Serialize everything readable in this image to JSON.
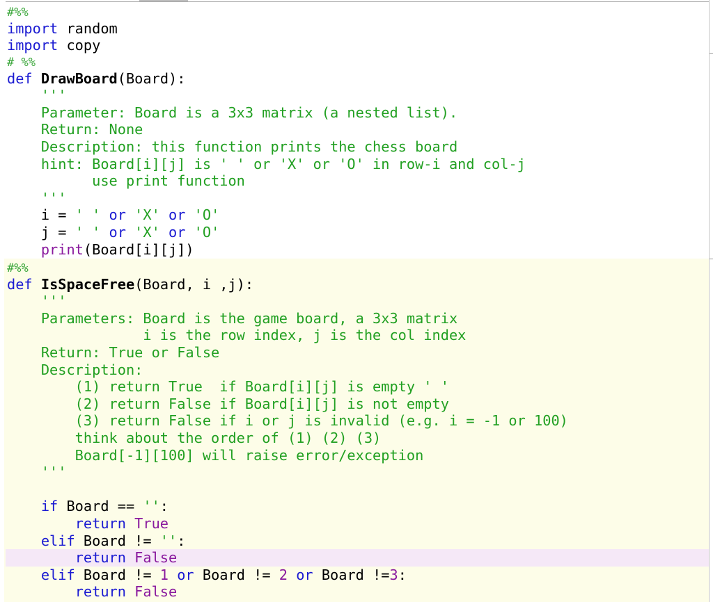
{
  "cells": [
    {
      "id": "cell-1",
      "lines": [
        [
          {
            "t": "#%%",
            "c": "cm"
          }
        ],
        [
          {
            "t": "import",
            "c": "kw"
          },
          {
            "t": " random",
            "c": "op"
          }
        ],
        [
          {
            "t": "import",
            "c": "kw"
          },
          {
            "t": " copy",
            "c": "op"
          }
        ]
      ]
    },
    {
      "id": "cell-2",
      "lines": [
        [
          {
            "t": "# %%",
            "c": "cm"
          }
        ],
        [
          {
            "t": "def",
            "c": "kw"
          },
          {
            "t": " ",
            "c": "op"
          },
          {
            "t": "DrawBoard",
            "c": "fn"
          },
          {
            "t": "(Board):",
            "c": "op"
          }
        ],
        [
          {
            "t": "    '''",
            "c": "st"
          }
        ],
        [
          {
            "t": "    Parameter: Board is a 3x3 matrix (a nested list).",
            "c": "st"
          }
        ],
        [
          {
            "t": "    Return: None",
            "c": "st"
          }
        ],
        [
          {
            "t": "    Description: this function prints the chess board",
            "c": "st"
          }
        ],
        [
          {
            "t": "    hint: Board[i][j] is ' ' or 'X' or 'O' in row-i and col-j",
            "c": "st"
          }
        ],
        [
          {
            "t": "          use print function",
            "c": "st"
          }
        ],
        [
          {
            "t": "    '''",
            "c": "st"
          }
        ],
        [
          {
            "t": "    i = ",
            "c": "op"
          },
          {
            "t": "' '",
            "c": "st"
          },
          {
            "t": " or ",
            "c": "kw"
          },
          {
            "t": "'X'",
            "c": "st"
          },
          {
            "t": " or ",
            "c": "kw"
          },
          {
            "t": "'O'",
            "c": "st"
          }
        ],
        [
          {
            "t": "    j = ",
            "c": "op"
          },
          {
            "t": "' '",
            "c": "st"
          },
          {
            "t": " or ",
            "c": "kw"
          },
          {
            "t": "'X'",
            "c": "st"
          },
          {
            "t": " or ",
            "c": "kw"
          },
          {
            "t": "'O'",
            "c": "st"
          }
        ],
        [
          {
            "t": "    ",
            "c": "op"
          },
          {
            "t": "print",
            "c": "bi"
          },
          {
            "t": "(Board[i][j])",
            "c": "op"
          }
        ]
      ]
    },
    {
      "id": "cell-3",
      "lines": [
        [
          {
            "t": "#%%",
            "c": "cm"
          }
        ],
        [
          {
            "t": "def",
            "c": "kw"
          },
          {
            "t": " ",
            "c": "op"
          },
          {
            "t": "IsSpaceFree",
            "c": "fn"
          },
          {
            "t": "(Board, i ,j):",
            "c": "op"
          }
        ],
        [
          {
            "t": "    '''",
            "c": "st"
          }
        ],
        [
          {
            "t": "    Parameters: Board is the game board, a 3x3 matrix",
            "c": "st"
          }
        ],
        [
          {
            "t": "                i is the row index, j is the col index",
            "c": "st"
          }
        ],
        [
          {
            "t": "    Return: True or False",
            "c": "st"
          }
        ],
        [
          {
            "t": "    Description:",
            "c": "st"
          }
        ],
        [
          {
            "t": "        (1) return True  if Board[i][j] is empty ' '",
            "c": "st"
          }
        ],
        [
          {
            "t": "        (2) return False if Board[i][j] is not empty",
            "c": "st"
          }
        ],
        [
          {
            "t": "        (3) return False if i or j is invalid (e.g. i = -1 or 100)",
            "c": "st"
          }
        ],
        [
          {
            "t": "        think about the order of (1) (2) (3)",
            "c": "st"
          }
        ],
        [
          {
            "t": "        Board[-1][100] will raise error/exception",
            "c": "st"
          }
        ],
        [
          {
            "t": "    '''",
            "c": "st"
          }
        ],
        [
          {
            "t": "",
            "c": "op"
          }
        ],
        [
          {
            "t": "    ",
            "c": "op"
          },
          {
            "t": "if",
            "c": "kw"
          },
          {
            "t": " Board == ",
            "c": "op"
          },
          {
            "t": "''",
            "c": "st"
          },
          {
            "t": ":",
            "c": "op"
          }
        ],
        [
          {
            "t": "        ",
            "c": "op"
          },
          {
            "t": "return",
            "c": "kw"
          },
          {
            "t": " ",
            "c": "op"
          },
          {
            "t": "True",
            "c": "bi"
          }
        ],
        [
          {
            "t": "    ",
            "c": "op"
          },
          {
            "t": "elif",
            "c": "kw"
          },
          {
            "t": " Board != ",
            "c": "op"
          },
          {
            "t": "''",
            "c": "st"
          },
          {
            "t": ":",
            "c": "op"
          }
        ],
        [
          {
            "t": "        ",
            "c": "op"
          },
          {
            "t": "return",
            "c": "kw"
          },
          {
            "t": " ",
            "c": "op"
          },
          {
            "t": "False",
            "c": "bi"
          }
        ],
        [
          {
            "t": "    ",
            "c": "op"
          },
          {
            "t": "elif",
            "c": "kw"
          },
          {
            "t": " Board != ",
            "c": "op"
          },
          {
            "t": "1",
            "c": "nm"
          },
          {
            "t": " or ",
            "c": "kw"
          },
          {
            "t": "Board != ",
            "c": "op"
          },
          {
            "t": "2",
            "c": "nm"
          },
          {
            "t": " or ",
            "c": "kw"
          },
          {
            "t": "Board !=",
            "c": "op"
          },
          {
            "t": "3",
            "c": "nm"
          },
          {
            "t": ":",
            "c": "op"
          }
        ],
        [
          {
            "t": "        ",
            "c": "op"
          },
          {
            "t": "return",
            "c": "kw"
          },
          {
            "t": " ",
            "c": "op"
          },
          {
            "t": "False",
            "c": "bi"
          }
        ]
      ]
    }
  ],
  "highlight": {
    "cell": "cell-3",
    "line": 17
  },
  "colors": {
    "keyword": "#1b1bd2",
    "string": "#22a022",
    "comment": "#3aa63a",
    "builtin": "#8a1a9e",
    "active_cell_bg": "#fdfde8",
    "current_line_bg": "#f5e8f7"
  }
}
